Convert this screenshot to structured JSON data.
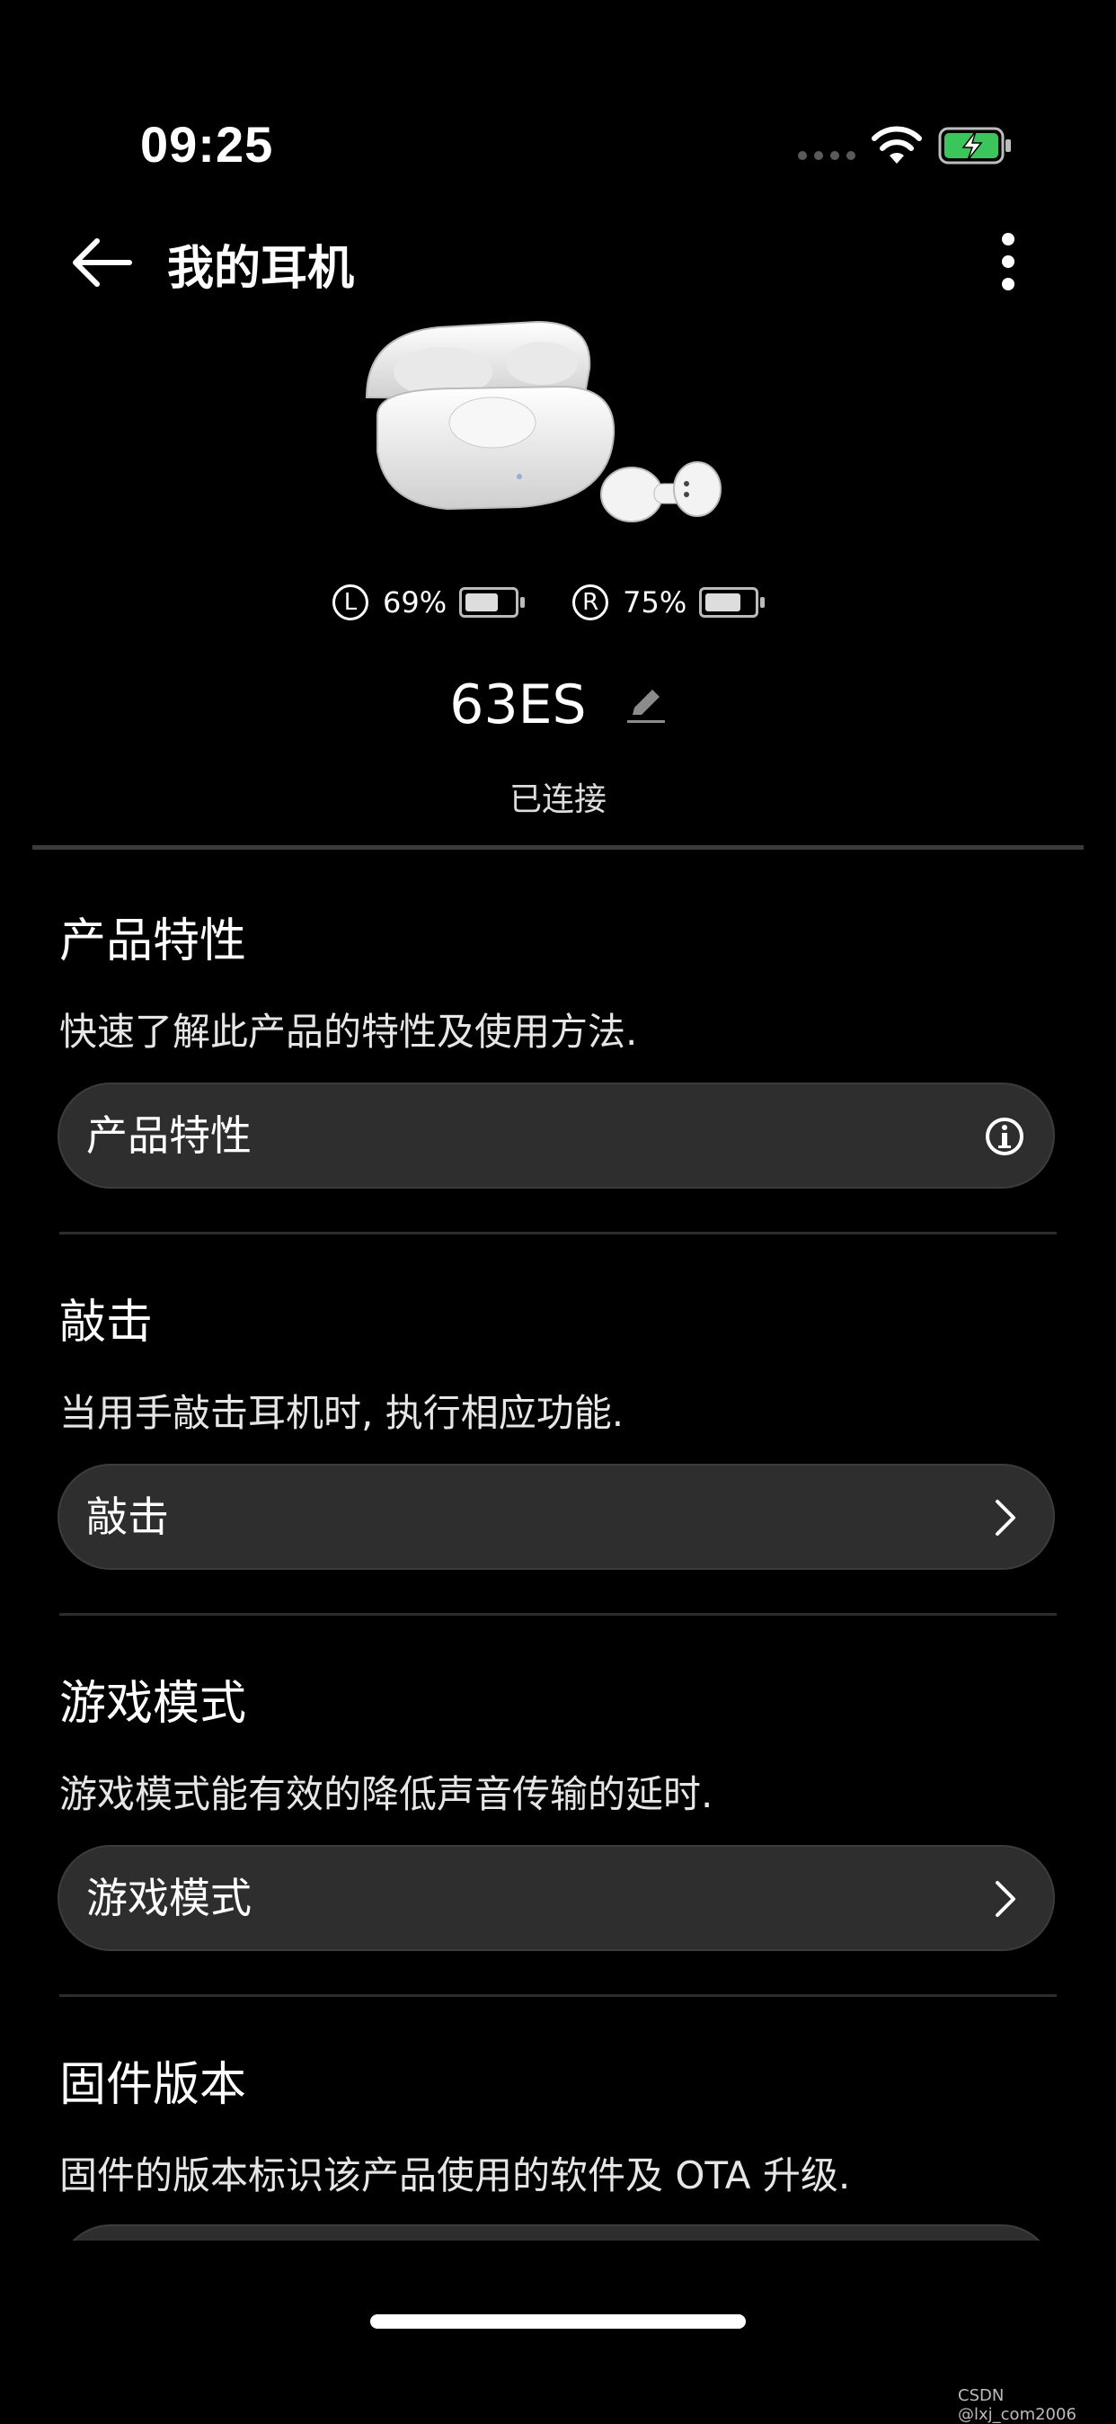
{
  "status_bar": {
    "time": "09:25"
  },
  "header": {
    "title": "我的耳机"
  },
  "battery": {
    "left": {
      "label": "L",
      "percent_text": "69%",
      "level": 0.69
    },
    "right": {
      "label": "R",
      "percent_text": "75%",
      "level": 0.75
    }
  },
  "device": {
    "name": "63ES",
    "status": "已连接"
  },
  "sections": [
    {
      "title": "产品特性",
      "desc": "快速了解此产品的特性及使用方法.",
      "button": "产品特性",
      "icon": "info-icon"
    },
    {
      "title": "敲击",
      "desc": "当用手敲击耳机时, 执行相应功能.",
      "button": "敲击",
      "icon": "chevron-right-icon"
    },
    {
      "title": "游戏模式",
      "desc": "游戏模式能有效的降低声音传输的延时.",
      "button": "游戏模式",
      "icon": "chevron-right-icon"
    },
    {
      "title": "固件版本",
      "desc": "固件的版本标识该产品使用的软件及 OTA 升级."
    }
  ],
  "colors": {
    "background": "#000000",
    "pill": "#2e2e2e",
    "charging_green": "#3ac65a"
  },
  "watermark": "CSDN @lxj_com2006"
}
